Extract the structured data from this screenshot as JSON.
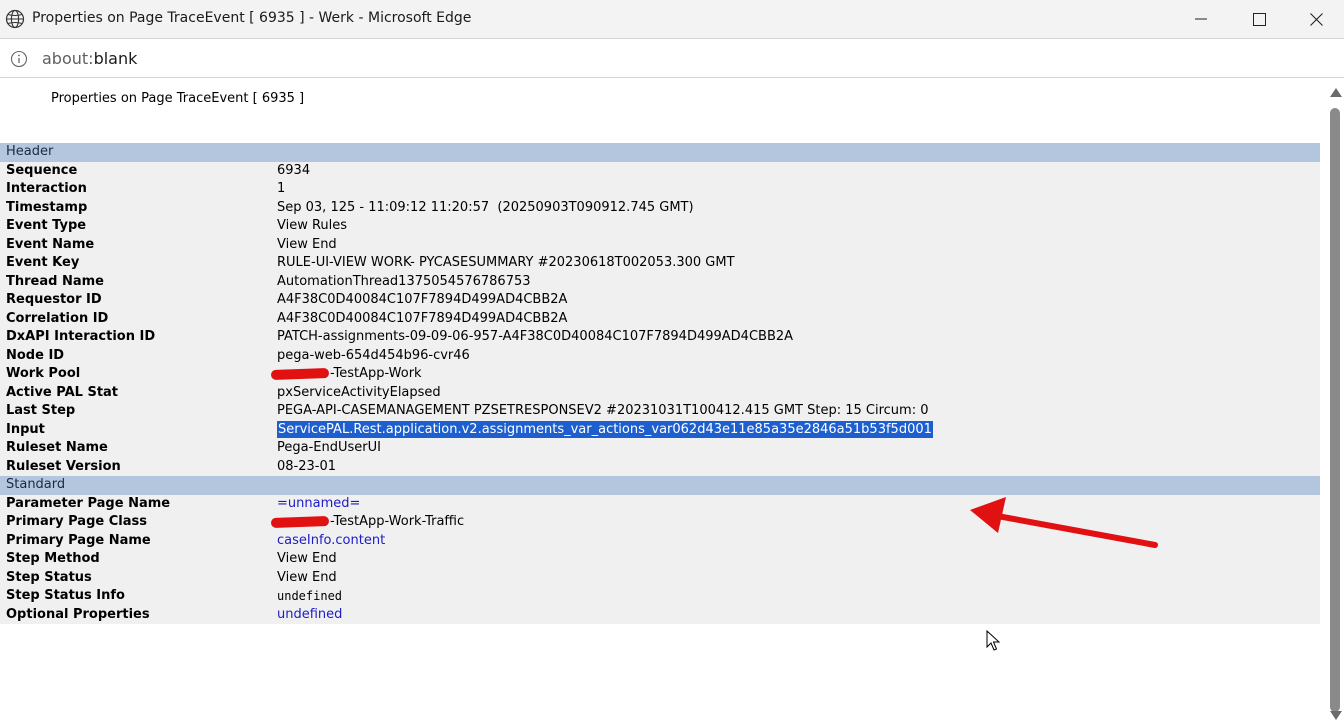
{
  "window": {
    "title": "Properties on Page TraceEvent [ 6935 ] - Werk - Microsoft Edge",
    "icon": "globe-icon"
  },
  "address_bar": {
    "url_prefix": "about:",
    "url_rest": "blank"
  },
  "page": {
    "heading": "Properties on Page TraceEvent [ 6935 ]"
  },
  "sections": {
    "header": {
      "label": "Header",
      "rows": [
        {
          "key": "Sequence",
          "value": "6934"
        },
        {
          "key": "Interaction",
          "value": "1"
        },
        {
          "key": "Timestamp",
          "value": "Sep 03, 125 - 11:09:12 11:20:57  (20250903T090912.745 GMT)"
        },
        {
          "key": "Event Type",
          "value": "View Rules"
        },
        {
          "key": "Event Name",
          "value": "View End"
        },
        {
          "key": "Event Key",
          "value": "RULE-UI-VIEW WORK- PYCASESUMMARY #20230618T002053.300 GMT"
        },
        {
          "key": "Thread Name",
          "value": "AutomationThread1375054576786753"
        },
        {
          "key": "Requestor ID",
          "value": "A4F38C0D40084C107F7894D499AD4CBB2A"
        },
        {
          "key": "Correlation ID",
          "value": "A4F38C0D40084C107F7894D499AD4CBB2A"
        },
        {
          "key": "DxAPI Interaction ID",
          "value": "PATCH-assignments-09-09-06-957-A4F38C0D40084C107F7894D499AD4CBB2A"
        },
        {
          "key": "Node ID",
          "value": "pega-web-654d454b96-cvr46"
        },
        {
          "key": "Work Pool",
          "value": "-TestApp-Work"
        },
        {
          "key": "Active PAL Stat",
          "value": "pxServiceActivityElapsed"
        },
        {
          "key": "Last Step",
          "value": "PEGA-API-CASEMANAGEMENT PZSETRESPONSEV2 #20231031T100412.415 GMT Step: 15 Circum: 0"
        },
        {
          "key": "Input",
          "value": "ServicePAL.Rest.application.v2.assignments_var_actions_var062d43e11e85a35e2846a51b53f5d001"
        },
        {
          "key": "Ruleset Name",
          "value": "Pega-EndUserUI"
        },
        {
          "key": "Ruleset Version",
          "value": "08-23-01"
        }
      ]
    },
    "standard": {
      "label": "Standard",
      "rows": [
        {
          "key": "Parameter Page Name",
          "value": "=unnamed="
        },
        {
          "key": "Primary Page Class",
          "value": "-TestApp-Work-Traffic"
        },
        {
          "key": "Primary Page Name",
          "value": "caseInfo.content"
        },
        {
          "key": "Step Method",
          "value": "View End"
        },
        {
          "key": "Step Status",
          "value": "View End"
        },
        {
          "key": "Step Status Info",
          "value": "undefined"
        },
        {
          "key": "Optional Properties",
          "value": "undefined"
        }
      ]
    }
  },
  "colors": {
    "section_header_bg": "#b3c6de",
    "row_bg": "#f0f0f0",
    "link_text": "#1c1cc7",
    "selection_bg": "#1d5fcf",
    "annotation_red": "#e21111"
  }
}
